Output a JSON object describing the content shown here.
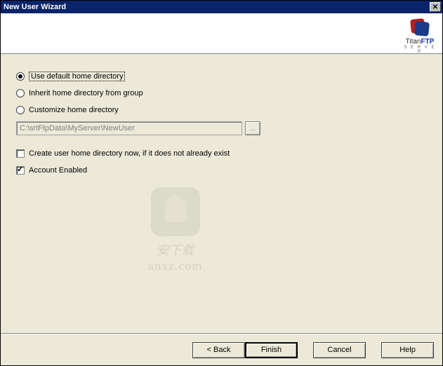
{
  "window": {
    "title": "New User Wizard"
  },
  "logo": {
    "brand": "Titan",
    "product": "FTP",
    "sub": "S E R V E R"
  },
  "options": {
    "default_home": "Use default home directory",
    "inherit_home": "Inherit home directory from group",
    "custom_home": "Customize home directory",
    "selected": "default_home"
  },
  "path": {
    "value": "C:\\srtFtpData\\MyServer\\NewUser",
    "browse_label": "..."
  },
  "checks": {
    "create_dir": {
      "label": "Create user home directory now, if it does not already exist",
      "checked": false
    },
    "enabled": {
      "label": "Account Enabled",
      "checked": true
    }
  },
  "buttons": {
    "back": "< Back",
    "finish": "Finish",
    "cancel": "Cancel",
    "help": "Help"
  },
  "watermark": {
    "text": "安下载",
    "url": "anxz.com"
  }
}
